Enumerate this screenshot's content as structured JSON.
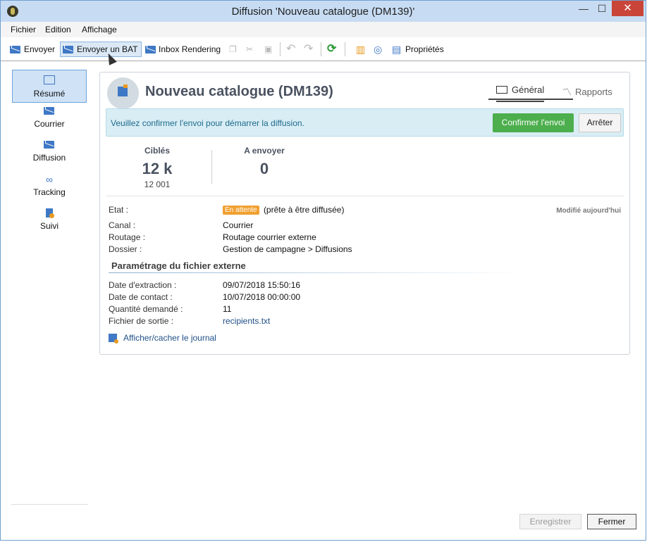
{
  "window": {
    "title": "Diffusion 'Nouveau catalogue (DM139)'",
    "min_glyph": "—",
    "max_glyph": "☐",
    "close_glyph": "✕"
  },
  "menu": [
    "Fichier",
    "Edition",
    "Affichage"
  ],
  "toolbar": {
    "send": "Envoyer",
    "send_proof": "Envoyer un BAT",
    "inbox_rendering": "Inbox Rendering",
    "properties": "Propriétés"
  },
  "sidebar": [
    {
      "label": "Résumé",
      "icon": "summary-icon"
    },
    {
      "label": "Courrier",
      "icon": "mail-star-icon"
    },
    {
      "label": "Diffusion",
      "icon": "delivery-icon"
    },
    {
      "label": "Tracking",
      "icon": "tracking-icon"
    },
    {
      "label": "Suivi",
      "icon": "follow-up-icon"
    }
  ],
  "header": {
    "title": "Nouveau catalogue (DM139)",
    "tabs": [
      "Général",
      "Rapports"
    ]
  },
  "banner": {
    "message": "Veuillez confirmer l'envoi pour démarrer la diffusion.",
    "confirm": "Confirmer l'envoi",
    "stop": "Arrêter"
  },
  "stats": {
    "targeted_label": "Ciblés",
    "targeted_value": "12 k",
    "targeted_exact": "12 001",
    "to_send_label": "A envoyer",
    "to_send_value": "0"
  },
  "details": {
    "state_label": "Etat :",
    "state_badge": "En attente",
    "state_text": "(prête à être diffusée)",
    "modified": "Modifié aujourd'hui",
    "channel_label": "Canal :",
    "channel_value": "Courrier",
    "routing_label": "Routage :",
    "routing_value": "Routage courrier externe",
    "folder_label": "Dossier :",
    "folder_value": "Gestion de campagne > Diffusions"
  },
  "external_file": {
    "section_title": "Paramétrage du fichier externe",
    "extraction_label": "Date d'extraction :",
    "extraction_value": "09/07/2018 15:50:16",
    "contact_label": "Date de contact :",
    "contact_value": "10/07/2018 00:00:00",
    "quantity_label": "Quantité demandé :",
    "quantity_value": "11",
    "output_label": "Fichier de sortie :",
    "output_value": "recipients.txt"
  },
  "journal_link": "Afficher/cacher le journal",
  "footer": {
    "save": "Enregistrer",
    "close": "Fermer"
  },
  "colors": {
    "accent": "#3f78c5",
    "confirm_green": "#4cae4c",
    "badge_orange": "#f0a030",
    "banner_bg": "#d9edf5"
  }
}
